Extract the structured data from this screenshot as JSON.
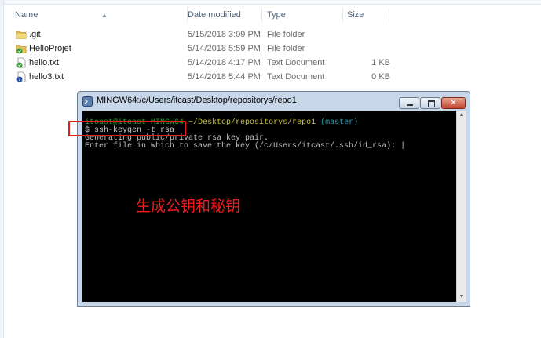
{
  "explorer": {
    "columns": [
      "Name",
      "Date modified",
      "Type",
      "Size"
    ],
    "files": [
      {
        "name": ".git",
        "date": "5/15/2018 3:09 PM",
        "type": "File folder",
        "size": ""
      },
      {
        "name": "HelloProjet",
        "date": "5/14/2018 5:59 PM",
        "type": "File folder",
        "size": ""
      },
      {
        "name": "hello.txt",
        "date": "5/14/2018 4:17 PM",
        "type": "Text Document",
        "size": "1 KB"
      },
      {
        "name": "hello3.txt",
        "date": "5/14/2018 5:44 PM",
        "type": "Text Document",
        "size": "0 KB"
      }
    ]
  },
  "terminal": {
    "title": "MINGW64:/c/Users/itcast/Desktop/repositorys/repo1",
    "prompt_user": "itcast@itcast-MINGW64",
    "prompt_path": "~/Desktop/repositorys/repo1",
    "prompt_branch": "(master)",
    "command": "$ ssh-keygen -t rsa",
    "output_1": "Generating public/private rsa key pair.",
    "output_2": "Enter file in which to save the key (/c/Users/itcast/.ssh/id_rsa): |"
  },
  "annotation": {
    "text": "生成公钥和秘钥",
    "color": "#ee1c1c"
  }
}
